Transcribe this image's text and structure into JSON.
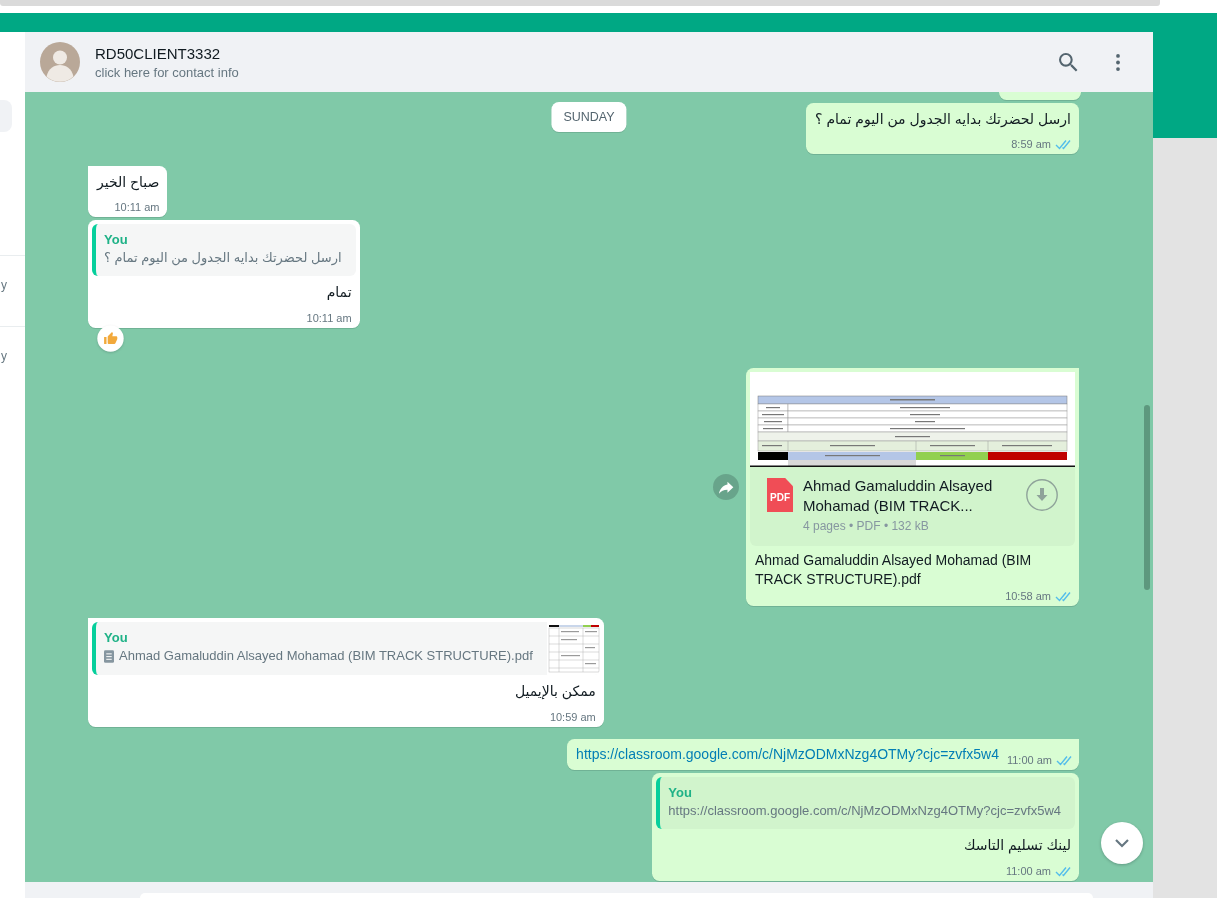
{
  "sidebar": {
    "items": [
      {
        "time": "y"
      },
      {
        "time": "y"
      }
    ]
  },
  "chat": {
    "contact": {
      "name": "RD50CLIENT3332",
      "subtitle": "click here for contact info"
    },
    "date_chip": "SUNDAY",
    "messages": [
      {
        "kind": "cut_off",
        "outgoing": true
      },
      {
        "kind": "text",
        "outgoing": true,
        "tail": false,
        "text": "ارسل لحضرتك بدايه الجدول من اليوم تمام ؟",
        "time": "8:59 am",
        "read": true
      },
      {
        "kind": "text",
        "outgoing": false,
        "tail": true,
        "text": "صباح الخير",
        "time": "10:11 am"
      },
      {
        "kind": "reply",
        "outgoing": false,
        "tail": false,
        "quote": {
          "author": "You",
          "kind": "text",
          "text": "ارسل لحضرتك بدايه الجدول من اليوم تمام ؟"
        },
        "text": "تمام",
        "time": "10:11 am",
        "reaction": {
          "kind": "thumbs_up"
        }
      },
      {
        "kind": "document",
        "outgoing": true,
        "tail": true,
        "forward": true,
        "file": {
          "badge": "PDF",
          "name": "Ahmad Gamaluddin Alsayed Mohamad (BIM TRACK...",
          "meta": "4 pages • PDF • 132 kB"
        },
        "caption": "Ahmad Gamaluddin Alsayed Mohamad (BIM TRACK STRUCTURE).pdf",
        "time": "10:58 am",
        "read": true
      },
      {
        "kind": "reply",
        "outgoing": false,
        "tail": true,
        "quote": {
          "author": "You",
          "kind": "document",
          "text": "Ahmad Gamaluddin Alsayed Mohamad (BIM TRACK STRUCTURE).pdf",
          "thumbnail": true
        },
        "text": "ممكن بالإيميل",
        "time": "10:59 am"
      },
      {
        "kind": "link",
        "outgoing": true,
        "tail": true,
        "text": "https://classroom.google.com/c/NjMzODMxNzg4OTMy?cjc=zvfx5w4",
        "time": "11:00 am",
        "read": true
      },
      {
        "kind": "reply",
        "outgoing": true,
        "tail": false,
        "quote": {
          "author": "You",
          "kind": "text",
          "text": "https://classroom.google.com/c/NjMzODMxNzg4OTMy?cjc=zvfx5w4"
        },
        "text": "لينك تسليم التاسك",
        "time": "11:00 am",
        "read": true
      }
    ]
  }
}
